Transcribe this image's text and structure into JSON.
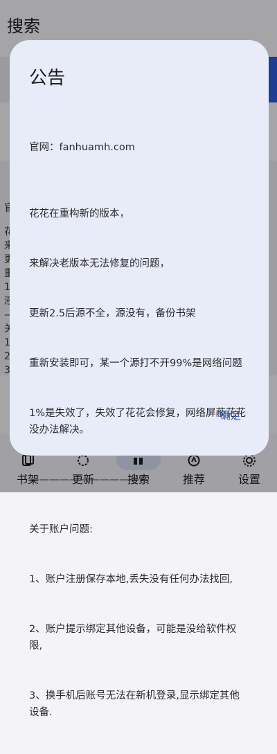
{
  "app": {
    "title": "搜索"
  },
  "background_peek": [
    "官",
    "花",
    "来",
    "更",
    "重",
    "1",
    "液",
    "—",
    "关",
    "1",
    "2",
    "3"
  ],
  "dialog": {
    "title": "公告",
    "official_site": "官网：fanhuamh.com",
    "body_lines": [
      "花花在重构新的版本，",
      "来解决老版本无法修复的问题，",
      "更新2.5后源不全，源没有，备份书架",
      "重新安装即可，某一个源打不开99%是网络问题",
      "1%是失效了，失效了花花会修复，网络屏蔽花花没办法解决。",
      "————————————",
      "关于账户问题:",
      "1、账户注册保存本地,丢失没有任何办法找回,",
      "2、账户提示绑定其他设备，可能是没给软件权限,",
      "3、换手机后账号无法在新机登录,显示绑定其他设备."
    ],
    "confirm_label": "确定"
  },
  "bottom_nav": {
    "items": [
      {
        "label": "书架",
        "icon": "bookshelf-icon",
        "active": false
      },
      {
        "label": "更新",
        "icon": "update-icon",
        "active": false
      },
      {
        "label": "搜索",
        "icon": "search-icon",
        "active": true
      },
      {
        "label": "推荐",
        "icon": "recommend-icon",
        "active": false
      },
      {
        "label": "设置",
        "icon": "settings-icon",
        "active": false
      }
    ]
  },
  "colors": {
    "accent": "#2a5bd7",
    "dialog_bg": "#e8ecf8",
    "active_pill": "#d4d9ef"
  }
}
